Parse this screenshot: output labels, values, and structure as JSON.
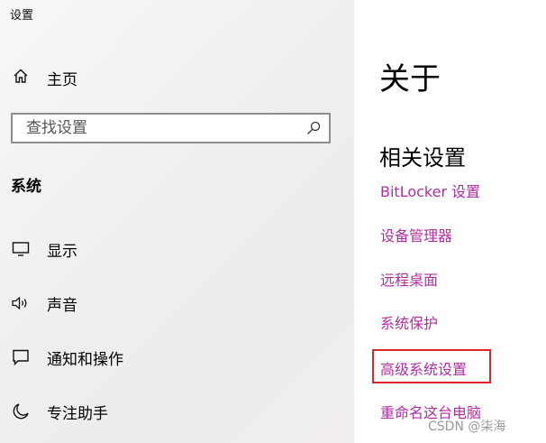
{
  "window": {
    "title": "设置"
  },
  "sidebar": {
    "home_label": "主页",
    "search": {
      "placeholder": "查找设置",
      "value": ""
    },
    "section_label": "系统",
    "items": [
      {
        "label": "显示",
        "icon": "monitor-icon"
      },
      {
        "label": "声音",
        "icon": "speaker-icon"
      },
      {
        "label": "通知和操作",
        "icon": "notification-icon"
      },
      {
        "label": "专注助手",
        "icon": "moon-icon"
      }
    ]
  },
  "main": {
    "title": "关于",
    "related_heading": "相关设置",
    "links": [
      {
        "label": "BitLocker 设置"
      },
      {
        "label": "设备管理器"
      },
      {
        "label": "远程桌面"
      },
      {
        "label": "系统保护"
      },
      {
        "label": "高级系统设置",
        "highlighted": true
      },
      {
        "label": "重命名这台电脑"
      }
    ]
  },
  "watermark": "CSDN @柒海",
  "colors": {
    "link": "#b02ea2",
    "highlight_border": "#e0252a",
    "sidebar_bg": "#f0f0f0"
  }
}
